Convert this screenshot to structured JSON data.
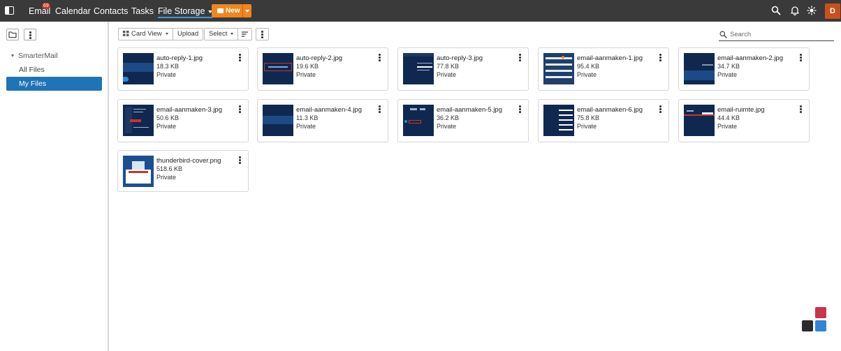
{
  "nav": {
    "email": "Email",
    "email_badge": "69",
    "calendar": "Calendar",
    "contacts": "Contacts",
    "tasks": "Tasks",
    "file_storage": "File Storage",
    "new_button": "New"
  },
  "user": {
    "avatar_initial": "D"
  },
  "sidebar": {
    "root": "SmarterMail",
    "items": [
      {
        "label": "All Files"
      },
      {
        "label": "My Files"
      }
    ]
  },
  "toolbar": {
    "card_view": "Card View",
    "upload": "Upload",
    "select": "Select",
    "search_placeholder": "Search"
  },
  "files": [
    {
      "name": "auto-reply-1.jpg",
      "size": "18.3 KB",
      "visibility": "Private"
    },
    {
      "name": "auto-reply-2.jpg",
      "size": "19.6 KB",
      "visibility": "Private"
    },
    {
      "name": "auto-reply-3.jpg",
      "size": "77.8 KB",
      "visibility": "Private"
    },
    {
      "name": "email-aanmaken-1.jpg",
      "size": "95.4 KB",
      "visibility": "Private"
    },
    {
      "name": "email-aanmaken-2.jpg",
      "size": "34.7 KB",
      "visibility": "Private"
    },
    {
      "name": "email-aanmaken-3.jpg",
      "size": "50.6 KB",
      "visibility": "Private"
    },
    {
      "name": "email-aanmaken-4.jpg",
      "size": "11.3 KB",
      "visibility": "Private"
    },
    {
      "name": "email-aanmaken-5.jpg",
      "size": "36.2 KB",
      "visibility": "Private"
    },
    {
      "name": "email-aanmaken-6.jpg",
      "size": "75.8 KB",
      "visibility": "Private"
    },
    {
      "name": "email-ruimte.jpg",
      "size": "44.4 KB",
      "visibility": "Private"
    },
    {
      "name": "thunderbird-cover.png",
      "size": "518.6 KB",
      "visibility": "Private"
    }
  ],
  "colors": {
    "topbar": "#3a3a3a",
    "accent_orange": "#f0861c",
    "selected_blue": "#1f73b7",
    "thumbnail_navy": "#10284f",
    "avatar": "#c8501e"
  }
}
